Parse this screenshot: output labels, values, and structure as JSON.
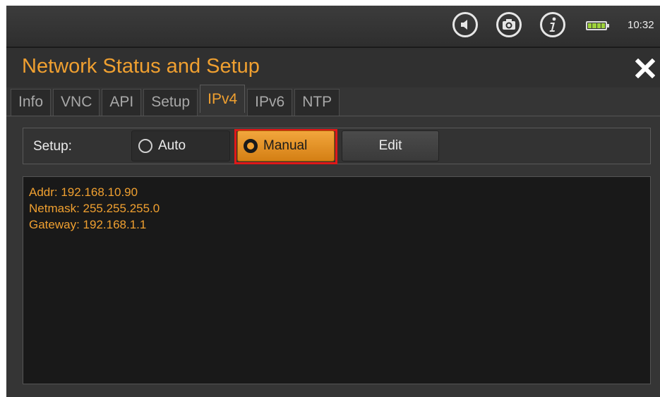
{
  "status_bar": {
    "clock": "10:32",
    "icons": [
      "speaker-icon",
      "camera-icon",
      "info-icon",
      "battery-icon"
    ],
    "battery_level": 0.8
  },
  "header": {
    "title": "Network Status and Setup",
    "close_icon": "close-icon"
  },
  "tabs": [
    {
      "label": "Info",
      "active": false
    },
    {
      "label": "VNC",
      "active": false
    },
    {
      "label": "API",
      "active": false
    },
    {
      "label": "Setup",
      "active": false
    },
    {
      "label": "IPv4",
      "active": true
    },
    {
      "label": "IPv6",
      "active": false
    },
    {
      "label": "NTP",
      "active": false
    }
  ],
  "setup": {
    "label": "Setup:",
    "auto_label": "Auto",
    "manual_label": "Manual",
    "edit_label": "Edit",
    "selected": "Manual"
  },
  "info": {
    "lines": [
      "Addr: 192.168.10.90",
      "Netmask: 255.255.255.0",
      "Gateway: 192.168.1.1"
    ]
  },
  "colors": {
    "accent": "#f0a030",
    "highlight": "#e01818",
    "background": "#353535",
    "panel": "#191919"
  }
}
